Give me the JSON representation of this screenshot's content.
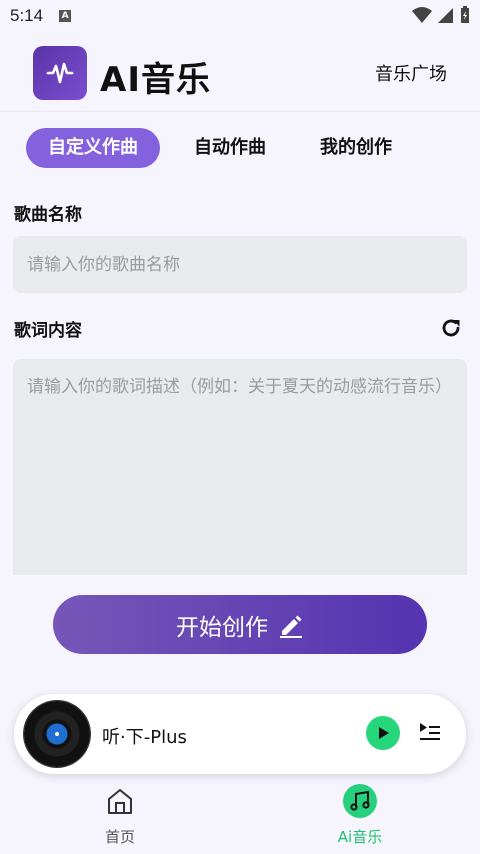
{
  "status_bar": {
    "time": "5:14",
    "notification": "A"
  },
  "header": {
    "title": "AI音乐",
    "plaza_link": "音乐广场"
  },
  "tabs": [
    {
      "label": "自定义作曲",
      "active": true
    },
    {
      "label": "自动作曲",
      "active": false
    },
    {
      "label": "我的创作",
      "active": false
    }
  ],
  "form": {
    "song_name_label": "歌曲名称",
    "song_name_placeholder": "请输入你的歌曲名称",
    "song_name_value": "",
    "lyrics_label": "歌词内容",
    "lyrics_placeholder": "请输入你的歌词描述（例如：关于夏天的动感流行音乐）",
    "lyrics_value": ""
  },
  "start_button": {
    "label": "开始创作",
    "icon": "edit-icon"
  },
  "player": {
    "song_title": "听·下-Plus",
    "play_icon": "play-icon",
    "queue_icon": "playlist-icon"
  },
  "bottom_nav": [
    {
      "label": "首页",
      "icon": "home-icon",
      "active": false
    },
    {
      "label": "Ai音乐",
      "icon": "music-note-icon",
      "active": true
    }
  ],
  "colors": {
    "accent": "#8562dd",
    "button_gradient_start": "#7657b8",
    "button_gradient_end": "#5434b0",
    "green": "#25d67a"
  }
}
